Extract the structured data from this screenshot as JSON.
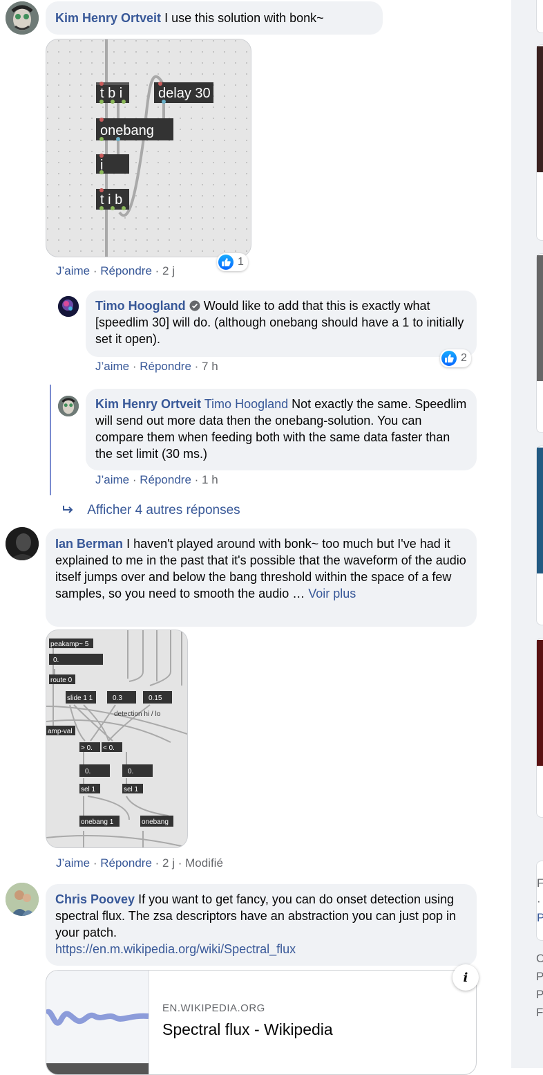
{
  "comments": [
    {
      "author": "Kim Henry Ortveit",
      "text": "I use this solution with bonk~",
      "actions": {
        "like": "J’aime",
        "sep1": " · ",
        "reply": "Répondre",
        "sep2": " · ",
        "time": "2 j"
      },
      "reactions": "1",
      "patch": {
        "objects": [
          "t b i",
          "delay 30",
          "onebang",
          "i",
          "t i b"
        ]
      }
    },
    {
      "author": "Timo Hoogland",
      "text": "Would like to add that this is exactly what [speedlim 30] will do. (although onebang should have a 1 to initially set it open).",
      "actions": {
        "like": "J’aime",
        "sep1": " · ",
        "reply": "Répondre",
        "sep2": " · ",
        "time": "7 h"
      },
      "reactions": "2"
    },
    {
      "author": "Kim Henry Ortveit",
      "mention": "Timo Hoogland",
      "text": "Not exactly the same. Speedlim will send out more data then the onebang-solution. You can compare them when feeding both with the same data faster than the set limit (30 ms.)",
      "actions": {
        "like": "J’aime",
        "sep1": " · ",
        "reply": "Répondre",
        "sep2": " · ",
        "time": "1 h"
      }
    },
    {
      "author": "Ian Berman",
      "text": "I haven't played around with bonk~ too much but I've had it explained to me in the past that it's possible that the waveform of the audio itself jumps over and below the bang threshold within the space of a few samples, so you need to smooth the audio …",
      "see_more": "Voir plus",
      "actions": {
        "like": "J’aime",
        "sep1": " · ",
        "reply": "Répondre",
        "sep2": " · ",
        "time": "2 j",
        "sep3": " · ",
        "edited": "Modifié"
      },
      "patch": {
        "objects": [
          "peakamp~ 5",
          "0.",
          "route 0",
          "slide 1 1",
          "0.3",
          "0.15",
          "detection hi / lo",
          "amp-val",
          "> 0.",
          "< 0.",
          "0.",
          "0.",
          "sel 1",
          "sel 1",
          "onebang 1",
          "onebang"
        ]
      }
    },
    {
      "author": "Chris Poovey",
      "text": "If you want to get fancy, you can do onset detection using spectral flux. The zsa descriptors have an abstraction you can just pop in your patch.",
      "url": "https://en.m.wikipedia.org/wiki/Spectral_flux",
      "preview": {
        "domain": "EN.WIKIPEDIA.ORG",
        "title": "Spectral flux - Wikipedia"
      }
    }
  ],
  "more_replies": "Afficher 4 autres réponses",
  "right_snippets": [
    "F",
    "·",
    "P",
    "C",
    "P",
    "P",
    "F"
  ],
  "colors": {
    "link": "#385898",
    "bubble": "#f0f2f5",
    "meta": "#65676b",
    "like": "#0866ff"
  }
}
